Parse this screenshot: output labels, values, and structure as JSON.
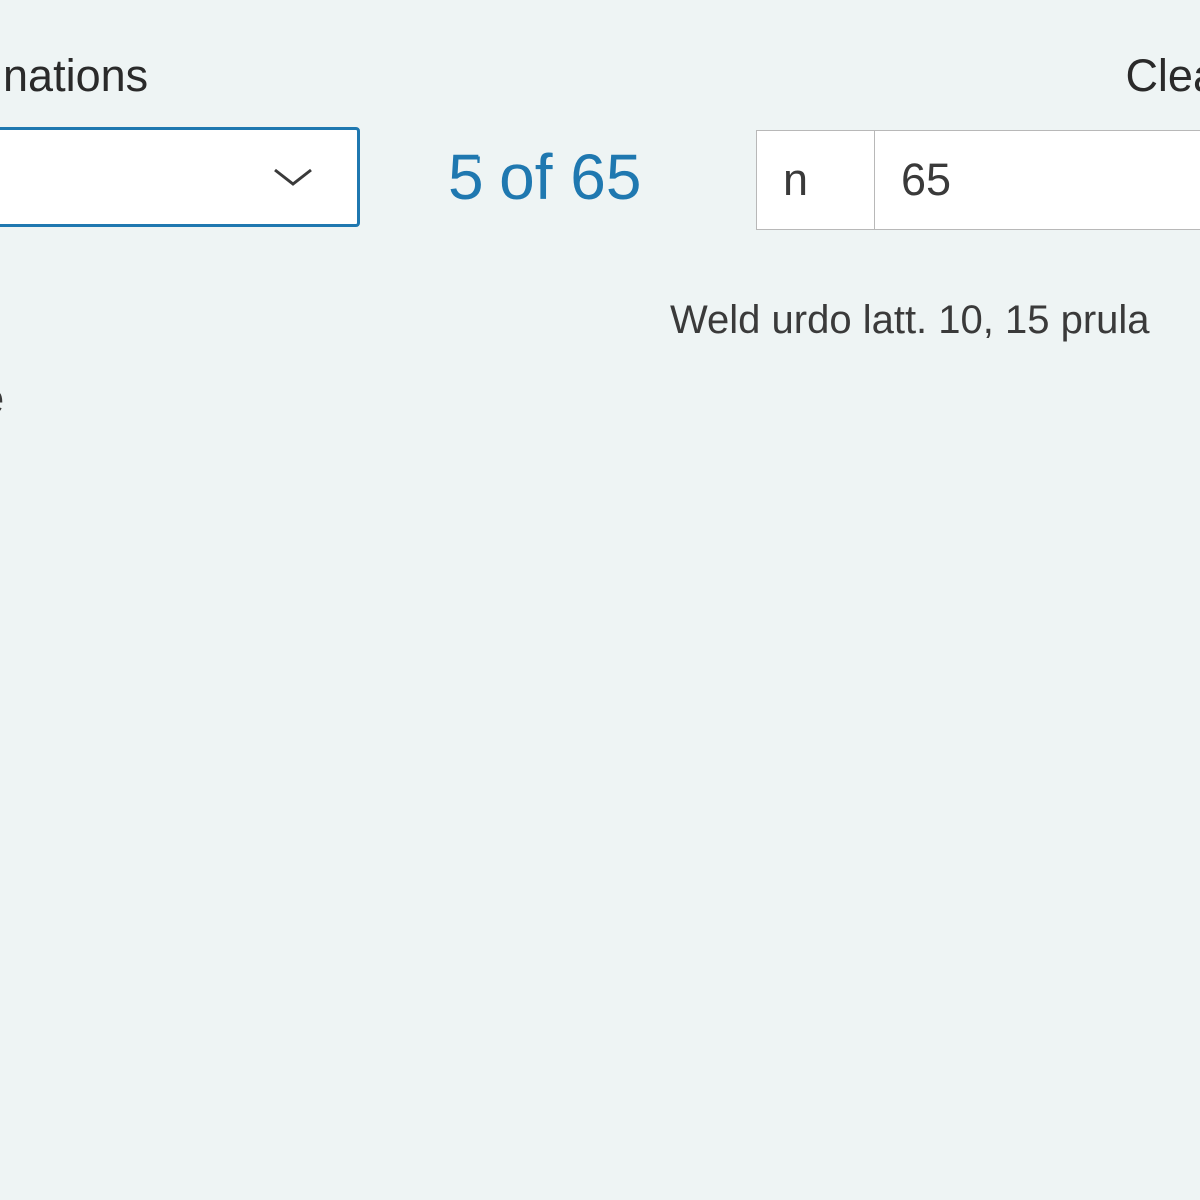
{
  "header": {
    "left_label": "ainations",
    "right_label": "Clea"
  },
  "dropdown": {
    "value": ""
  },
  "count": {
    "number": "5",
    "sup": "'",
    "of_word": "of",
    "total": "65"
  },
  "input": {
    "n_label": "n",
    "value": "65"
  },
  "hint": "Weld urdo latt. 10, 15 prula",
  "secondary": "le"
}
